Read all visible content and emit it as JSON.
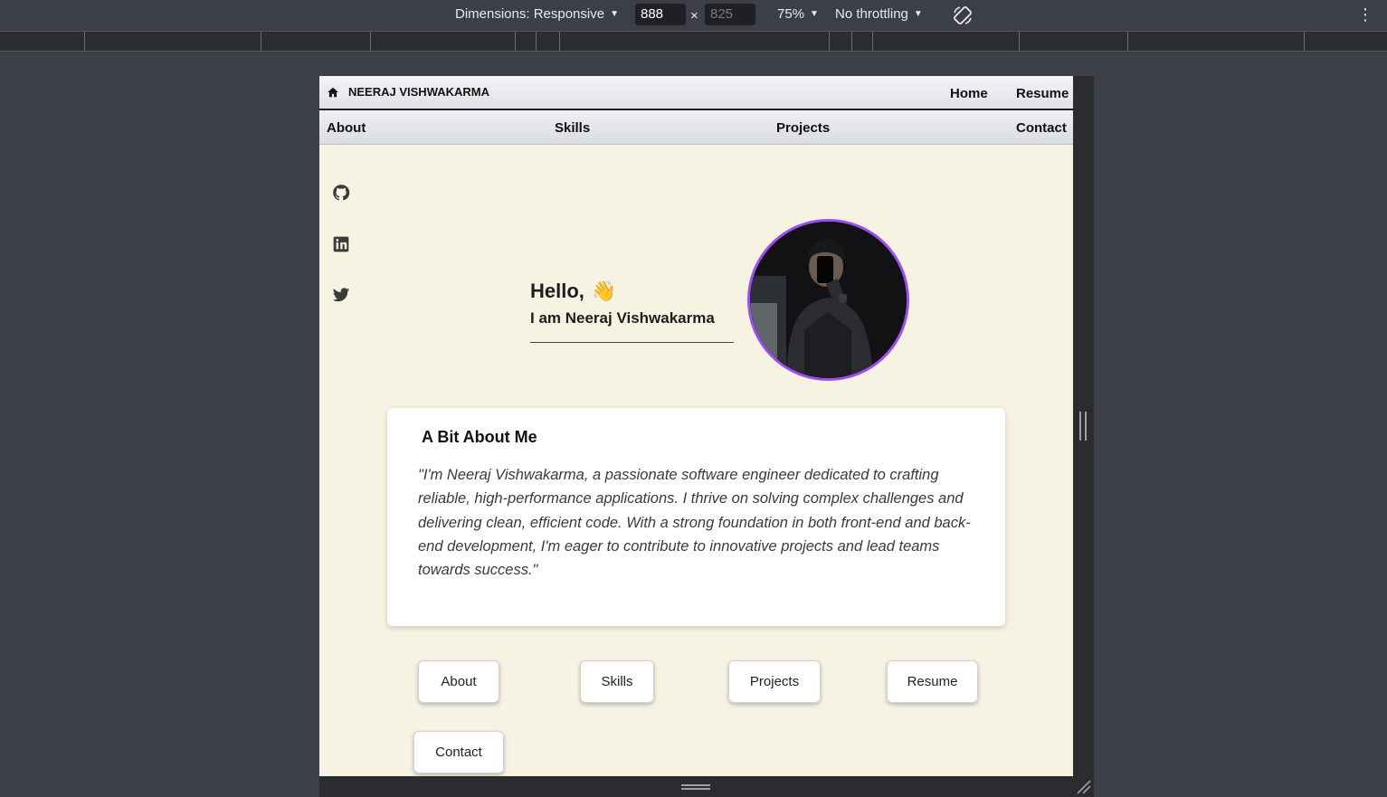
{
  "devtools": {
    "dimensions_label": "Dimensions: Responsive",
    "width_value": "888",
    "height_value": "825",
    "times": "×",
    "zoom": "75%",
    "throttling": "No throttling"
  },
  "header": {
    "brand": "NEERAJ VISHWAKARMA",
    "home": "Home",
    "resume": "Resume"
  },
  "subnav": {
    "about": "About",
    "skills": "Skills",
    "projects": "Projects",
    "contact": "Contact"
  },
  "hero": {
    "greeting": "Hello,",
    "wave": "👋",
    "intro": "I am Neeraj Vishwakarma"
  },
  "about": {
    "title": "A Bit About Me",
    "text": "\"I'm Neeraj Vishwakarma, a passionate software engineer dedicated to crafting reliable, high-performance applications. I thrive on solving complex challenges and delivering clean, efficient code. With a strong foundation in both front-end and back-end development, I'm eager to contribute to innovative projects and lead teams towards success.\""
  },
  "buttons": {
    "about": "About",
    "skills": "Skills",
    "projects": "Projects",
    "resume": "Resume",
    "contact": "Contact"
  },
  "colors": {
    "page_bg": "#f6f3e2",
    "avatar_ring": "#9c4df4",
    "devtools_bg": "#3c3f47"
  }
}
